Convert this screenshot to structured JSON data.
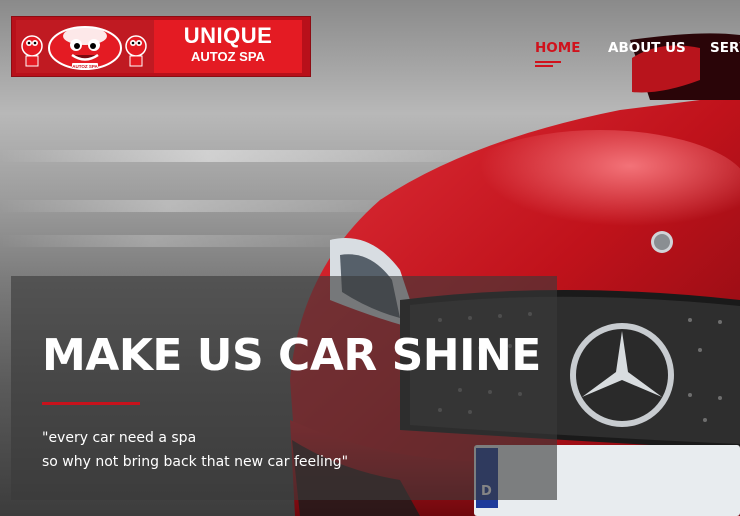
{
  "logo": {
    "line1": "UNIQUE",
    "line2": "AUTOZ SPA",
    "mascot_plate": "AUTOZ SPA"
  },
  "nav": {
    "items": [
      {
        "label": "HOME",
        "active": true
      },
      {
        "label": "ABOUT US",
        "active": false
      },
      {
        "label": "SERV",
        "active": false
      }
    ]
  },
  "hero": {
    "headline": "MAKE US CAR SHINE",
    "tagline_line1": "\"every car need a spa",
    "tagline_line2": "so why not bring back that new car feeling\"",
    "plate_letter": "D"
  },
  "colors": {
    "brand_red": "#d0121c",
    "car_red": "#c8141c",
    "panel": "rgba(58,58,58,0.62)"
  }
}
